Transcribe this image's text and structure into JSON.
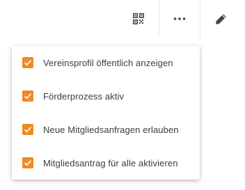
{
  "toolbar": {
    "buttons": [
      {
        "icon": "qr-code-icon"
      },
      {
        "icon": "more-horizontal-icon"
      },
      {
        "icon": "pencil-icon"
      }
    ],
    "icon_color": "#444444"
  },
  "menu": {
    "accent_color": "#f08a24",
    "items": [
      {
        "label": "Vereinsprofil öffentlich anzeigen",
        "checked": true
      },
      {
        "label": "Förderprozess aktiv",
        "checked": true
      },
      {
        "label": "Neue Mitgliedsanfragen erlauben",
        "checked": true
      },
      {
        "label": "Mitgliedsantrag für alle aktivieren",
        "checked": true
      }
    ]
  }
}
